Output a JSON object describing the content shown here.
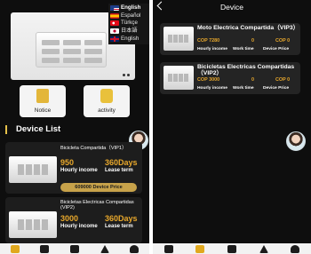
{
  "colors": {
    "background": "#0e0e0e",
    "accent": "#e8a82c",
    "gold_button": "#c7a24a",
    "card": "#1d1d1d"
  },
  "left": {
    "languages": [
      {
        "label": "English",
        "flag": "us-flag-icon",
        "selected": true
      },
      {
        "label": "Español",
        "flag": "spain-flag-icon",
        "selected": false
      },
      {
        "label": "Türkçe",
        "flag": "turkey-flag-icon",
        "selected": false
      },
      {
        "label": "日本語",
        "flag": "japan-flag-icon",
        "selected": false
      },
      {
        "label": "English",
        "flag": "uk-flag-icon",
        "selected": false
      }
    ],
    "tiles": [
      {
        "label": "Notice",
        "icon": "notice-book-icon"
      },
      {
        "label": "activity",
        "icon": "activity-star-icon"
      }
    ],
    "section_title": "Device List",
    "devices": [
      {
        "name": "Bicicleta Compartida（VIP1）",
        "hourly_income": "950",
        "hourly_income_label": "Hourly income",
        "lease_term": "360Days",
        "lease_term_label": "Lease term",
        "price_label": "609000 Device Price"
      },
      {
        "name": "Bicicletas Electricas Compartidas (VIP2)",
        "hourly_income": "3000",
        "hourly_income_label": "Hourly income",
        "lease_term": "360Days",
        "lease_term_label": "Lease term"
      }
    ]
  },
  "right": {
    "title": "Device",
    "devices": [
      {
        "name": "Moto Electrica Compartida（VIP3）",
        "values": [
          "COP 7280",
          "0",
          "COP 0"
        ],
        "captions": [
          "Hourly income",
          "Work time",
          "Device Price"
        ]
      },
      {
        "name": "Bicicletas Electricas Compartidas （VIP2）",
        "values": [
          "COP 3000",
          "0",
          "COP 0"
        ],
        "captions": [
          "Hourly income",
          "Work time",
          "Device Price"
        ]
      }
    ]
  },
  "nav_icons": [
    "home-icon",
    "device-icon",
    "chart-icon",
    "send-icon",
    "profile-icon"
  ]
}
